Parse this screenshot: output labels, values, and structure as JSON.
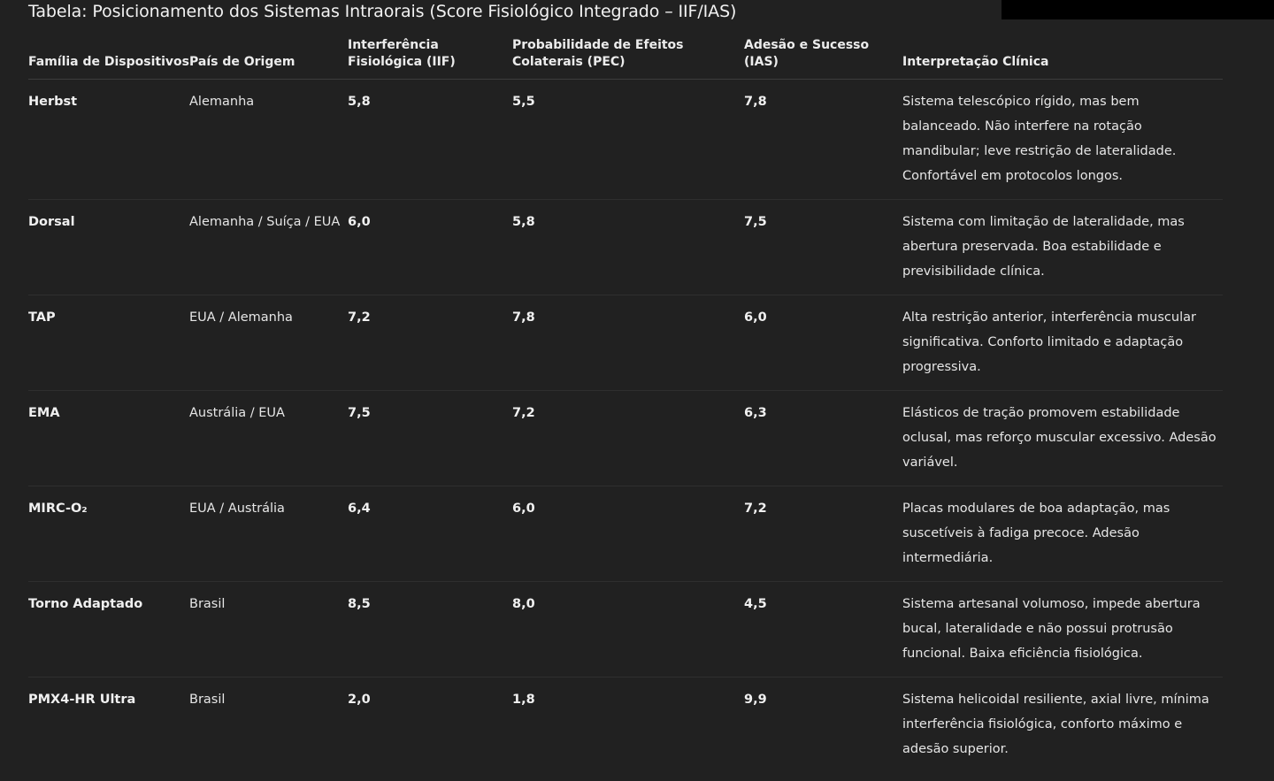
{
  "title": "Tabela: Posicionamento dos Sistemas Intraorais (Score Fisiológico Integrado – IIF/IAS)",
  "headers": {
    "family": "Família de Dispositivos",
    "country": "País de Origem",
    "iif": "Interferência Fisiológica (IIF)",
    "pec": "Probabilidade de Efeitos Colaterais (PEC)",
    "ias": "Adesão e Sucesso (IAS)",
    "interp": "Interpretação Clínica"
  },
  "rows": [
    {
      "family": "Herbst",
      "country": "Alemanha",
      "iif": "5,8",
      "pec": "5,5",
      "ias": "7,8",
      "interp": "Sistema telescópico rígido, mas bem balanceado. Não interfere na rotação mandibular; leve restrição de lateralidade. Confortável em protocolos longos."
    },
    {
      "family": "Dorsal",
      "country": "Alemanha / Suíça / EUA",
      "iif": "6,0",
      "pec": "5,8",
      "ias": "7,5",
      "interp": "Sistema com limitação de lateralidade, mas abertura preservada. Boa estabilidade e previsibilidade clínica."
    },
    {
      "family": "TAP",
      "country": "EUA / Alemanha",
      "iif": "7,2",
      "pec": "7,8",
      "ias": "6,0",
      "interp": "Alta restrição anterior, interferência muscular significativa. Conforto limitado e adaptação progressiva."
    },
    {
      "family": "EMA",
      "country": "Austrália / EUA",
      "iif": "7,5",
      "pec": "7,2",
      "ias": "6,3",
      "interp": "Elásticos de tração promovem estabilidade oclusal, mas reforço muscular excessivo. Adesão variável."
    },
    {
      "family": "MIRC-O₂",
      "country": "EUA / Austrália",
      "iif": "6,4",
      "pec": "6,0",
      "ias": "7,2",
      "interp": "Placas modulares de boa adaptação, mas suscetíveis à fadiga precoce. Adesão intermediária."
    },
    {
      "family": "Torno Adaptado",
      "country": "Brasil",
      "iif": "8,5",
      "pec": "8,0",
      "ias": "4,5",
      "interp": "Sistema artesanal volumoso, impede abertura bucal, lateralidade e não possui protrusão funcional. Baixa eficiência fisiológica."
    },
    {
      "family": "PMX4-HR Ultra",
      "country": "Brasil",
      "iif": "2,0",
      "pec": "1,8",
      "ias": "9,9",
      "interp": "Sistema helicoidal resiliente, axial livre, mínima interferência fisiológica, conforto máximo e adesão superior."
    }
  ]
}
